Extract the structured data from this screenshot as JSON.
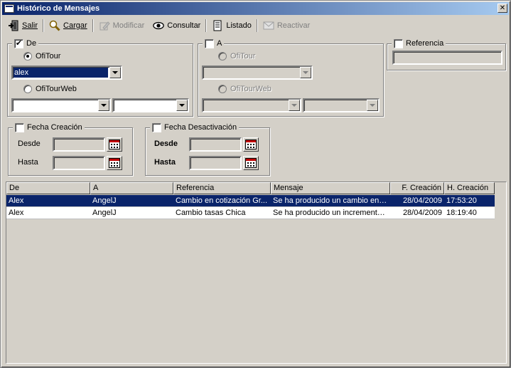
{
  "window": {
    "title": "Histórico de Mensajes",
    "close_glyph": "✕"
  },
  "toolbar": {
    "salir": "Salir",
    "cargar": "Cargar",
    "modificar": "Modificar",
    "consultar": "Consultar",
    "listado": "Listado",
    "reactivar": "Reactivar"
  },
  "de_group": {
    "label": "De",
    "checked": true,
    "radio_ofitour": "OfiTour",
    "radio_ofitourweb": "OfiTourWeb",
    "user_value": "alex"
  },
  "a_group": {
    "label": "A",
    "checked": false,
    "radio_ofitour": "OfiTour",
    "radio_ofitourweb": "OfiTourWeb"
  },
  "referencia_group": {
    "label": "Referencia",
    "checked": false
  },
  "fecha_creacion": {
    "label": "Fecha Creación",
    "desde": "Desde",
    "hasta": "Hasta"
  },
  "fecha_desactivacion": {
    "label": "Fecha Desactivación",
    "desde": "Desde",
    "hasta": "Hasta"
  },
  "grid": {
    "columns": [
      "De",
      "A",
      "Referencia",
      "Mensaje",
      "F. Creación",
      "H. Creación"
    ],
    "rows": [
      [
        "Alex",
        "AngelJ",
        "Cambio en cotización Gr...",
        "Se ha producido un cambio en l...",
        "28/04/2009",
        "17:53:20"
      ],
      [
        "Alex",
        "AngelJ",
        "Cambio tasas Chica",
        "Se ha producido un incremento...",
        "28/04/2009",
        "18:19:40"
      ]
    ]
  },
  "icons": {
    "salir": "exit-icon",
    "cargar": "magnifier-icon",
    "modificar": "edit-icon",
    "consultar": "eye-icon",
    "listado": "document-icon",
    "reactivar": "envelope-icon",
    "calendar": "calendar-icon"
  },
  "colors": {
    "title_start": "#0a246a",
    "title_end": "#a6caf0",
    "selection": "#0a246a",
    "face": "#d4d0c8"
  }
}
